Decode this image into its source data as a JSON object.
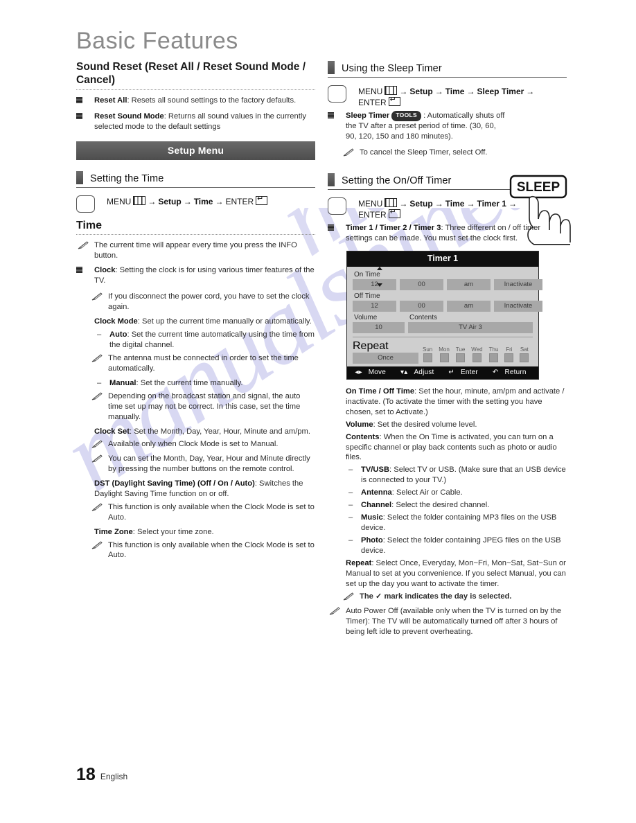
{
  "document": {
    "title": "Basic Features",
    "page_number": "18",
    "language": "English",
    "watermark": "manualshine.com"
  },
  "left_column": {
    "sound_reset": {
      "heading": "Sound Reset (Reset All / Reset Sound Mode / Cancel)",
      "items": [
        {
          "term": "Reset All",
          "text": ": Resets all sound settings to the factory defaults."
        },
        {
          "term": "Reset Sound Mode",
          "text": ": Returns all sound values in the currently selected mode to the default settings"
        }
      ]
    },
    "banner": "Setup Menu",
    "setting_the_time": {
      "section_title": "Setting the Time",
      "path": {
        "menu": "MENU",
        "steps": [
          "Setup",
          "Time"
        ],
        "enter": "ENTER"
      },
      "subheading": "Time",
      "note_info": "The current time will appear every time you press the INFO button.",
      "clock": {
        "term": "Clock",
        "text": ": Setting the clock is for using various timer features of the TV."
      },
      "clock_note": "If you disconnect the power cord, you have to set the clock again.",
      "clock_mode": {
        "term": "Clock Mode",
        "text": ": Set up the current time manually or automatically."
      },
      "auto": {
        "term": "Auto",
        "text": ": Set the current time automatically using the time from the digital channel."
      },
      "auto_note": "The antenna must be connected in order to set the time automatically.",
      "manual": {
        "term": "Manual",
        "text": ": Set the current time manually."
      },
      "manual_note": "Depending on the broadcast station and signal, the auto time set up may not be correct. In this case, set the time manually.",
      "clock_set_pre": "Clock Set",
      "clock_set": ": Set the Month, Day, Year, Hour, Minute and am/pm.",
      "clock_set_note1": "Available only when Clock Mode is set to Manual.",
      "clock_set_note2": "You can set the Month, Day, Year, Hour and Minute  directly by pressing the number buttons on the remote control.",
      "dst_term": "DST (Daylight Saving Time) (Off / On / Auto)",
      "dst_text": ": Switches the Daylight Saving Time function on or off.",
      "dst_note": "This function is only available when the Clock Mode is set to Auto.",
      "time_zone_term": "Time Zone",
      "time_zone_text": ": Select your time zone.",
      "time_zone_note": "This function is only available when the Clock Mode is set to Auto."
    }
  },
  "right_column": {
    "sleep_timer": {
      "section_title": "Using the Sleep Timer",
      "path": {
        "menu": "MENU",
        "steps": [
          "Setup",
          "Time",
          "Sleep Timer"
        ],
        "enter": "ENTER"
      },
      "term": "Sleep Timer",
      "tools_badge": "TOOLS",
      "text": " : Automatically shuts off the TV after a preset period of time. (30, 60, 90, 120, 150 and 180 minutes).",
      "note": "To cancel the Sleep Timer, select Off.",
      "remote_key_label": "SLEEP"
    },
    "onoff_timer": {
      "section_title": "Setting the On/Off Timer",
      "path": {
        "menu": "MENU",
        "steps": [
          "Setup",
          "Time",
          "Timer 1"
        ],
        "enter": "ENTER"
      },
      "term": "Timer 1 / Timer 2 / Timer 3",
      "text": ": Three different on / off timer settings can be made. You must set the clock first.",
      "osd": {
        "title": "Timer 1",
        "on_time_label": "On Time",
        "on_time": {
          "hour": "12",
          "minute": "00",
          "ampm": "am",
          "activate": "Inactivate"
        },
        "off_time_label": "Off Time",
        "off_time": {
          "hour": "12",
          "minute": "00",
          "ampm": "am",
          "activate": "Inactivate"
        },
        "volume_label": "Volume",
        "volume_value": "10",
        "contents_label": "Contents",
        "contents_value": "TV  Air  3",
        "repeat_label": "Repeat",
        "repeat_value": "Once",
        "days": [
          "Sun",
          "Mon",
          "Tue",
          "Wed",
          "Thu",
          "Fri",
          "Sat"
        ],
        "footer": {
          "move": "Move",
          "adjust": "Adjust",
          "enter": "Enter",
          "return": "Return"
        }
      },
      "on_off_term": "On Time / Off Time",
      "on_off_text": ": Set the hour, minute, am/pm and activate / inactivate. (To activate the timer with the setting you have chosen, set to Activate.)",
      "volume_term": "Volume",
      "volume_text": ": Set the desired volume level.",
      "contents_term": "Contents",
      "contents_text": ": When the On Time is activated, you can turn on a specific channel or play back contents such as photo or audio files.",
      "tv_usb": {
        "term": "TV/USB",
        "text": ": Select TV or USB. (Make sure that an USB device is connected to your TV.)"
      },
      "antenna": {
        "term": "Antenna",
        "text": ": Select Air or Cable."
      },
      "channel": {
        "term": "Channel",
        "text": ": Select the desired channel."
      },
      "music": {
        "term": "Music",
        "text": ": Select the folder containing MP3 files on the USB device."
      },
      "photo": {
        "term": "Photo",
        "text": ": Select the folder containing JPEG files on the USB device."
      },
      "repeat_term": "Repeat",
      "repeat_text": ": Select Once, Everyday, Mon~Fri, Mon~Sat, Sat~Sun or Manual to set at you convenience. If you select Manual, you can set up the day you want to activate the timer.",
      "check_note": "The ✓ mark indicates the day is selected.",
      "auto_power_off_note": "Auto Power Off (available only when the TV is turned on by the Timer): The TV will be automatically turned off after 3 hours of being left idle to prevent overheating."
    }
  }
}
